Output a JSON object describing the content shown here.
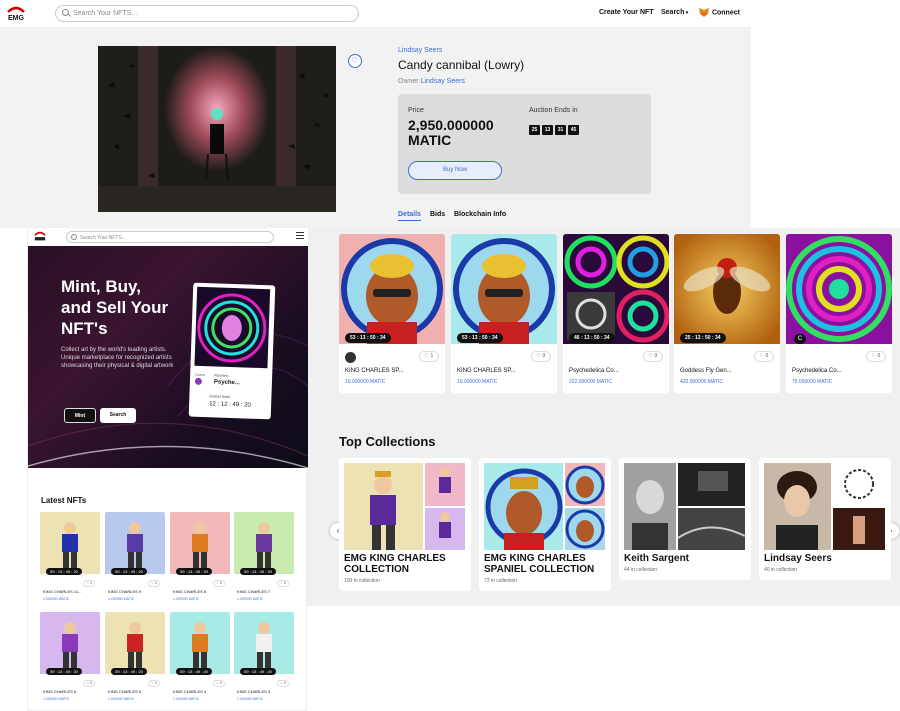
{
  "nav": {
    "logo_text": "EMG",
    "search_placeholder": "Search Your NFTS...",
    "create_nft": "Create Your NFT",
    "search": "Search",
    "connect": "Connect"
  },
  "detail": {
    "artist": "Lindsay Seers",
    "title": "Candy cannibal (Lowry)",
    "owner_label": "Owner",
    "owner_name": "Lindsay Seers",
    "price_label": "Price",
    "price_value": "2,950.000000",
    "price_unit": "MATIC",
    "auction_label": "Auction Ends in",
    "countdown": [
      "25",
      "13",
      "31",
      "45"
    ],
    "buy_button": "Buy Now",
    "tabs": [
      "Details",
      "Bids",
      "Blockchain Info"
    ]
  },
  "cards": [
    {
      "timer": "53 : 13 : 50 : 34",
      "likes": "1",
      "name": "KING CHARLES SP...",
      "price": "10.000000 MATIC"
    },
    {
      "timer": "53 : 13 : 50 : 34",
      "likes": "0",
      "name": "KING CHARLES SP...",
      "price": "10.000000 MATIC"
    },
    {
      "timer": "46 : 13 : 50 : 34",
      "likes": "0",
      "name": "Psychedelica Co...",
      "price": "222.000000 MATIC"
    },
    {
      "timer": "25 : 13 : 50 : 34",
      "likes": "0",
      "name": "Goddess Fly Gen...",
      "price": "420.000000 MATIC"
    },
    {
      "timer": "",
      "likes": "0",
      "name": "Psychedelica Co...",
      "price": "75.000000 MATIC"
    }
  ],
  "top_collections": {
    "heading": "Top Collections",
    "items": [
      {
        "title1": "EMG KING CHARLES",
        "title2": "COLLECTION",
        "sub": "100 in collection"
      },
      {
        "title1": "EMG KING CHARLES",
        "title2": "SPANIEL COLLECTION",
        "sub": "73 in collection"
      },
      {
        "title1": "Keith Sargent",
        "title2": "",
        "sub": "44 in collection"
      },
      {
        "title1": "Lindsay Seers",
        "title2": "",
        "sub": "40 in collection"
      }
    ]
  },
  "mobile": {
    "search_placeholder": "Search Your NFTS...",
    "hero_line1": "Mint, Buy,",
    "hero_line2": "and Sell Your",
    "hero_line3": "NFT's",
    "hero_desc": "Collect art by the world's leading artists. Unique marketplace for recognized artists showcasing their physical & digital artwork",
    "mint_button": "Mint",
    "search_button": "Search",
    "feature_owner_label": "Owner",
    "feature_owner_name": "Psyched...",
    "feature_title": "Psyche...",
    "feature_auction_label": "Auction Ends",
    "feature_countdown": "12 : 12 : 49 : 20",
    "latest_heading": "Latest NFTs",
    "latest": [
      {
        "timer": "59 : 13 : 49 : 20",
        "likes": "0",
        "name": "KING CHARLES 11...",
        "price": "1.000000 MATIC",
        "bg": "#ece2b4",
        "coat": "#2233aa"
      },
      {
        "timer": "59 : 13 : 49 : 20",
        "likes": "0",
        "name": "KING CHARLES 9",
        "price": "1.000000 MATIC",
        "bg": "#b8c8ee",
        "coat": "#5a3aa8"
      },
      {
        "timer": "59 : 13 : 49 : 20",
        "likes": "0",
        "name": "KING CHARLES 8",
        "price": "1.000000 MATIC",
        "bg": "#f0b8b8",
        "coat": "#e07a20"
      },
      {
        "timer": "59 : 13 : 49 : 20",
        "likes": "0",
        "name": "KING CHARLES 7",
        "price": "1.000000 MATIC",
        "bg": "#c8ecb0",
        "coat": "#6a3aa0"
      },
      {
        "timer": "59 : 13 : 49 : 20",
        "likes": "0",
        "name": "KING CHARLES 6",
        "price": "1.000000 MATIC",
        "bg": "#d6b8ee",
        "coat": "#8a3ab8"
      },
      {
        "timer": "59 : 13 : 49 : 20",
        "likes": "0",
        "name": "KING CHARLES 5",
        "price": "1.000000 MATIC",
        "bg": "#ece2b4",
        "coat": "#cc2222"
      },
      {
        "timer": "59 : 13 : 49 : 20",
        "likes": "0",
        "name": "KING CHARLES 4",
        "price": "1.000000 MATIC",
        "bg": "#a8eae6",
        "coat": "#e07a20"
      },
      {
        "timer": "59 : 13 : 49 : 20",
        "likes": "0",
        "name": "KING CHARLES 3",
        "price": "1.000000 MATIC",
        "bg": "#a8eae6",
        "coat": "#f0f0f0"
      }
    ]
  },
  "colors": {
    "accent": "#3b6fd6",
    "dark": "#111111"
  }
}
